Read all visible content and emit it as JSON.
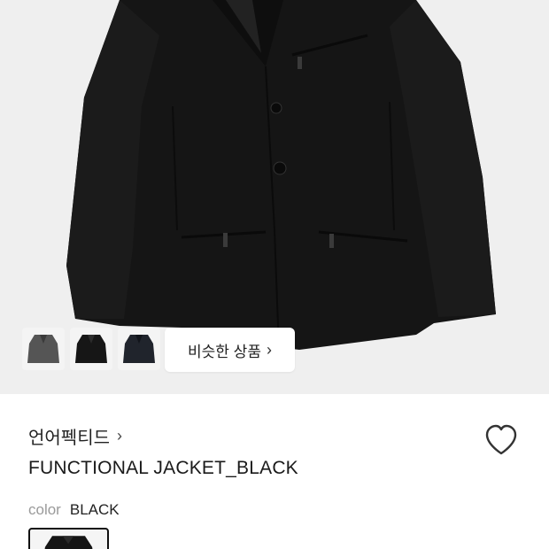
{
  "gallery": {
    "main_image": "jacket-photo",
    "thumbnails": [
      {
        "name": "thumbnail-gray-jacket",
        "tone": "#4a4a4a"
      },
      {
        "name": "thumbnail-black-jacket",
        "tone": "#1a1a1a"
      },
      {
        "name": "thumbnail-navy-jacket",
        "tone": "#20242c"
      }
    ],
    "similar_button_label": "비슷한 상품",
    "similar_button_icon": "chevron-right-icon"
  },
  "product": {
    "brand": "언어펙티드",
    "brand_icon": "chevron-right-icon",
    "title": "FUNCTIONAL JACKET_BLACK",
    "wishlist_icon": "heart-outline-icon",
    "color_label": "color",
    "color_value": "BLACK"
  },
  "colors": {
    "background": "#efefef",
    "jacket": "#151515"
  }
}
